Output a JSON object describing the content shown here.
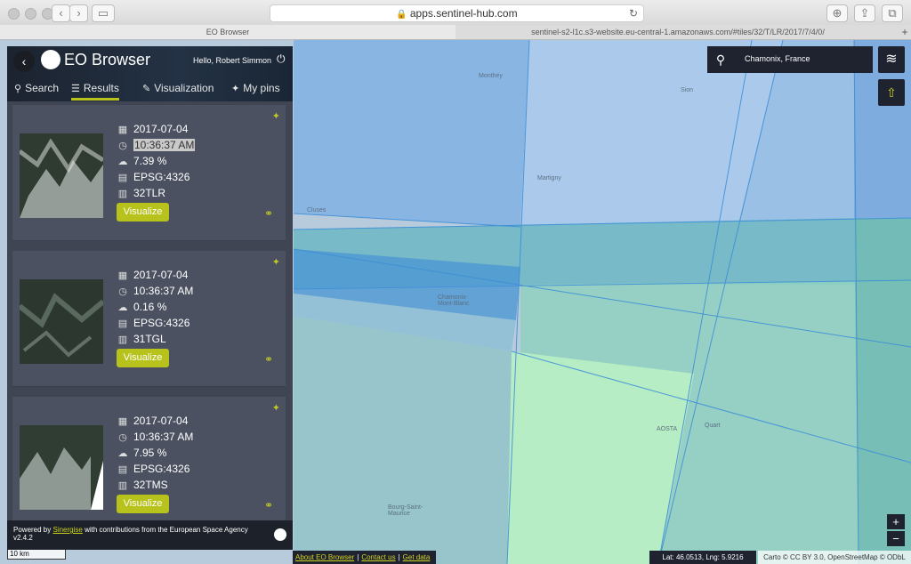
{
  "browser": {
    "url": "apps.sentinel-hub.com",
    "tabs": [
      {
        "label": "EO Browser"
      },
      {
        "label": "sentinel-s2-l1c.s3-website.eu-central-1.amazonaws.com/#tiles/32/T/LR/2017/7/4/0/"
      }
    ],
    "new_tab": "+"
  },
  "panel": {
    "back": "‹",
    "brand": "EO Browser",
    "greeting": "Hello, Robert Simmon",
    "nav": [
      {
        "label": "Search"
      },
      {
        "label": "Results"
      },
      {
        "label": "Visualization"
      },
      {
        "label": "My pins"
      }
    ],
    "results": [
      {
        "date": "2017-07-04",
        "time": "10:36:37 AM",
        "cloud": "7.39 %",
        "crs": "EPSG:4326",
        "tile": "32TLR",
        "button": "Visualize"
      },
      {
        "date": "2017-07-04",
        "time": "10:36:37 AM",
        "cloud": "0.16 %",
        "crs": "EPSG:4326",
        "tile": "31TGL",
        "button": "Visualize"
      },
      {
        "date": "2017-07-04",
        "time": "10:36:37 AM",
        "cloud": "7.95 %",
        "crs": "EPSG:4326",
        "tile": "32TMS",
        "button": "Visualize"
      }
    ],
    "footer": {
      "powered": "Powered by",
      "sinergise": "Sinergise",
      "rest": "with contributions from the European Space Agency",
      "version": "v2.4.2"
    }
  },
  "map": {
    "search_value": "Chamonix, France",
    "zoom_in": "+",
    "zoom_out": "−",
    "scale": "10 km",
    "links": [
      "About EO Browser",
      "Contact us",
      "Get data"
    ],
    "coords": "Lat: 46.0513, Lng: 5.9216",
    "attribution": "Carto © CC BY 3.0, OpenStreetMap © ODbL",
    "places": [
      "Monthey",
      "Sion",
      "Martigny",
      "Cluses",
      "Chamonix-Mont-Blanc",
      "AOSTA",
      "Quart",
      "Bourg-Saint-Maurice"
    ]
  },
  "colors": {
    "accent": "#b7c21c",
    "panel": "#3f4553",
    "dark": "#1f2330"
  }
}
